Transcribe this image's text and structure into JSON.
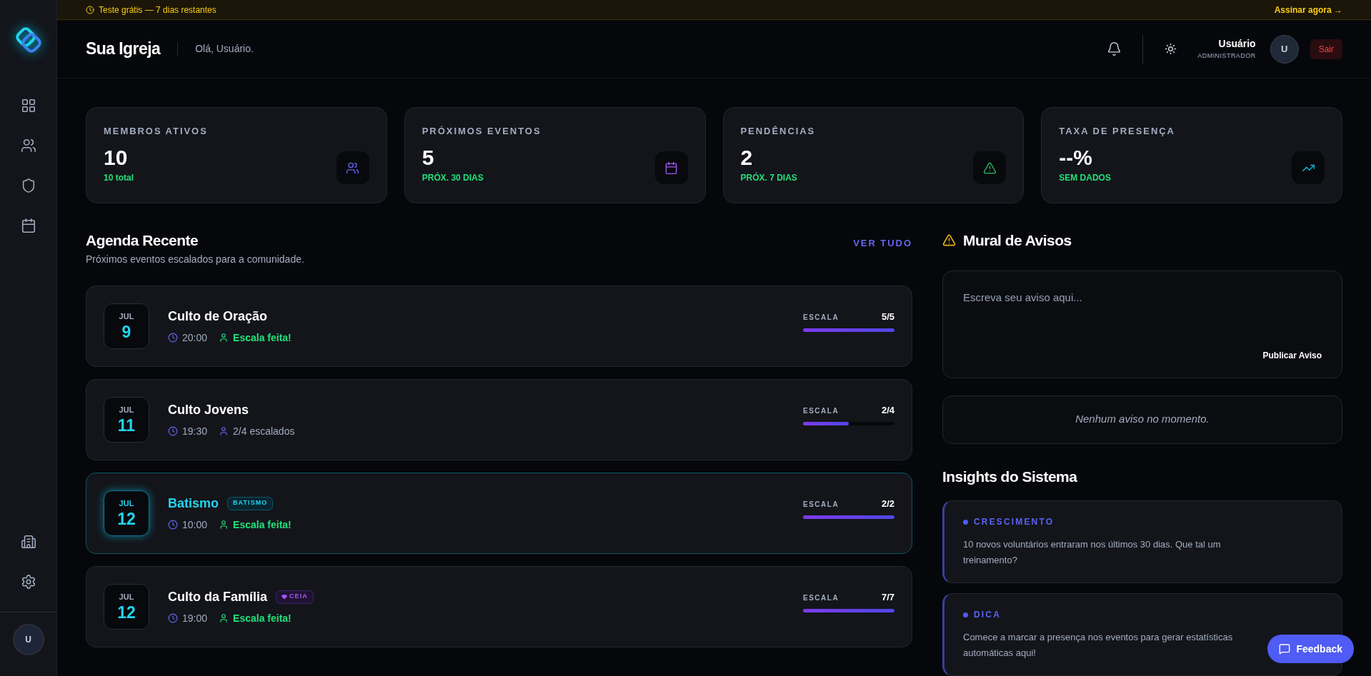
{
  "trial_banner": {
    "text": "Teste grátis — 7 dias restantes",
    "action": "Assinar agora →"
  },
  "sidebar": {
    "items": [
      {
        "selected": false
      },
      {
        "selected": false
      },
      {
        "selected": false
      },
      {
        "selected": false
      }
    ],
    "avatar": "U"
  },
  "header": {
    "title": "Sua Igreja",
    "greeting": "Olá, Usuário.",
    "user_name": "Usuário",
    "user_role": "ADMINISTRADOR",
    "avatar": "U",
    "logout": "Sair"
  },
  "stats": [
    {
      "label": "MEMBROS ATIVOS",
      "value": "10",
      "note": "10 total"
    },
    {
      "label": "PRÓXIMOS EVENTOS",
      "value": "5",
      "note": "PRÓX. 30 DIAS"
    },
    {
      "label": "PENDÊNCIAS",
      "value": "2",
      "note": "PRÓX. 7 DIAS"
    },
    {
      "label": "TAXA DE PRESENÇA",
      "value": "--%",
      "note": "SEM DADOS"
    }
  ],
  "agenda": {
    "title": "Agenda Recente",
    "subtitle": "Próximos eventos escalados para a comunidade.",
    "link": "VER TUDO",
    "events": [
      {
        "month": "JUL",
        "day": "9",
        "title": "Culto de Oração",
        "time": "20:00",
        "status": "Escala feita!",
        "complete": true,
        "highlighted": false,
        "scale_label": "ESCALA",
        "reading": "5/5",
        "level": 1
      },
      {
        "month": "JUL",
        "day": "11",
        "title": "Culto Jovens",
        "time": "19:30",
        "status": "2/4 escalados",
        "complete": false,
        "highlighted": false,
        "scale_label": "ESCALA",
        "reading": "2/4",
        "level": 0.5
      },
      {
        "month": "JUL",
        "day": "12",
        "title": "Batismo",
        "badge": {
          "label": "BATISMO",
          "kind": "plain"
        },
        "time": "10:00",
        "status": "Escala feita!",
        "complete": true,
        "highlighted": true,
        "scale_label": "ESCALA",
        "reading": "2/2",
        "level": 1
      },
      {
        "month": "JUL",
        "day": "12",
        "title": "Culto da Família",
        "badge": {
          "label": "CEIA",
          "kind": "heart"
        },
        "time": "19:00",
        "status": "Escala feita!",
        "complete": true,
        "highlighted": false,
        "scale_label": "ESCALA",
        "reading": "7/7",
        "level": 1
      }
    ]
  },
  "mural": {
    "title": "Mural de Avisos",
    "placeholder": "Escreva seu aviso aqui...",
    "publish": "Publicar Aviso",
    "empty": "Nenhum aviso no momento."
  },
  "insights": {
    "title": "Insights do Sistema",
    "items": [
      {
        "tag": "CRESCIMENTO",
        "text": "10 novos voluntários entraram nos últimos 30 dias. Que tal um treinamento?"
      },
      {
        "tag": "DICA",
        "text": "Comece a marcar a presença nos eventos para gerar estatísticas automáticas aqui!"
      }
    ]
  },
  "feedback": "Feedback"
}
